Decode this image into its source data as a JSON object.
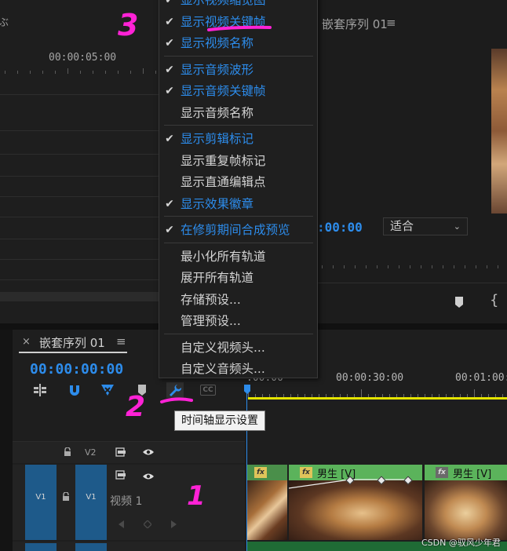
{
  "source_panel": {
    "title_fragment": "ぶ",
    "timecode": "00:00:05:00"
  },
  "program_monitor": {
    "title": "嵌套序列 01",
    "menu_icon": "≡",
    "timecode": ":00:00",
    "fit_select": {
      "value": "适合",
      "caret": "⌄"
    },
    "brace_glyph": "{"
  },
  "context_menu": {
    "items": [
      {
        "label": "显示视频缩览图",
        "checked": true
      },
      {
        "label": "显示视频关键帧",
        "checked": true
      },
      {
        "label": "显示视频名称",
        "checked": true
      },
      {
        "label": "显示音频波形",
        "checked": true
      },
      {
        "label": "显示音频关键帧",
        "checked": true
      },
      {
        "label": "显示音频名称",
        "checked": false
      },
      {
        "label": "显示剪辑标记",
        "checked": true
      },
      {
        "label": "显示重复帧标记",
        "checked": false
      },
      {
        "label": "显示直通编辑点",
        "checked": false
      },
      {
        "label": "显示效果徽章",
        "checked": true
      },
      {
        "label": "在修剪期间合成预览",
        "checked": true
      },
      {
        "label": "最小化所有轨道",
        "checked": false
      },
      {
        "label": "展开所有轨道",
        "checked": false
      },
      {
        "label": "存储预设...",
        "checked": false
      },
      {
        "label": "管理预设...",
        "checked": false
      },
      {
        "label": "自定义视频头...",
        "checked": false
      },
      {
        "label": "自定义音频头...",
        "checked": false
      }
    ],
    "check_glyph": "✔"
  },
  "timeline": {
    "tab_close": "×",
    "tab_title": "嵌套序列 01",
    "tab_menu": "≡",
    "timecode": "00:00:00:00",
    "ruler_labels": [
      ":00:00",
      "00:00:30:00",
      "00:01:00:"
    ],
    "cc_label": "CC",
    "tooltip": "时间轴显示设置",
    "tracks": {
      "v2": {
        "label": "V2"
      },
      "v1": {
        "source_label": "V1",
        "label": "V1",
        "name": "视频 1"
      }
    },
    "clips": [
      {
        "fx": "fx",
        "label": ""
      },
      {
        "fx": "fx",
        "label": "男生 [V]"
      },
      {
        "fx": "fx",
        "label": "男生 [V]"
      }
    ]
  },
  "annotations": {
    "step1": "1",
    "step2": "2",
    "step3": "3"
  },
  "watermark": "CSDN @驭风少年君",
  "colors": {
    "accent": "#2d8ceb",
    "annotation": "#ff22d6",
    "clip_header": "#5bb35b",
    "work_area": "#e4e400"
  }
}
